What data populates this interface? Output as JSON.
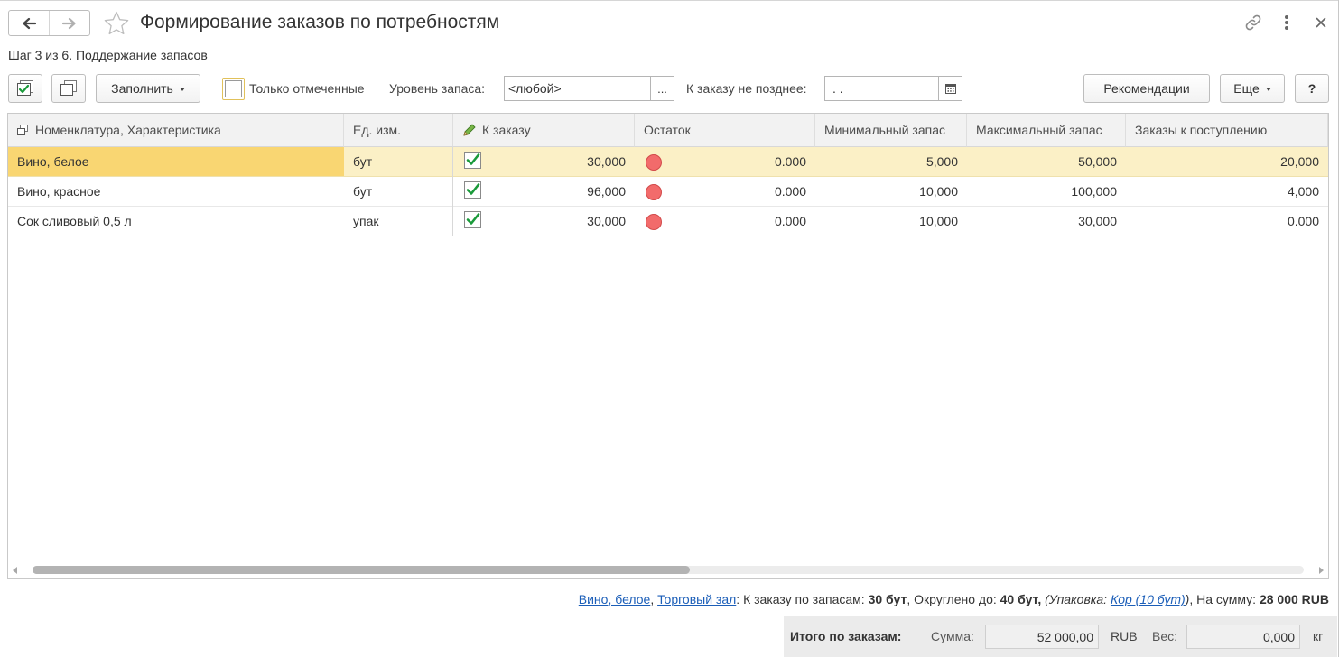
{
  "window": {
    "title": "Формирование заказов по потребностям",
    "step": "Шаг 3 из 6. Поддержание запасов"
  },
  "toolbar": {
    "fill_label": "Заполнить",
    "only_checked_label": "Только отмеченные",
    "stock_level_label": "Уровень запаса:",
    "stock_level_value": "<любой>",
    "stock_level_btn": "...",
    "order_by_label": "К заказу не позднее:",
    "order_by_value": " .  .",
    "recommend_label": "Рекомендации",
    "more_label": "Еще",
    "help_label": "?"
  },
  "table": {
    "columns": [
      "Номенклатура, Характеристика",
      "Ед. изм.",
      "К заказу",
      "Остаток",
      "Минимальный запас",
      "Максимальный запас",
      "Заказы к поступлению"
    ],
    "rows": [
      {
        "name": "Вино, белое",
        "unit": "бут",
        "checked": true,
        "to_order": "30,000",
        "stock": "0.000",
        "min": "5,000",
        "max": "50,000",
        "incoming": "20,000"
      },
      {
        "name": "Вино, красное",
        "unit": "бут",
        "checked": true,
        "to_order": "96,000",
        "stock": "0.000",
        "min": "10,000",
        "max": "100,000",
        "incoming": "4,000"
      },
      {
        "name": "Сок сливовый 0,5 л",
        "unit": "упак",
        "checked": true,
        "to_order": "30,000",
        "stock": "0.000",
        "min": "10,000",
        "max": "30,000",
        "incoming": "0.000"
      }
    ],
    "scroll_position": 0.0
  },
  "info": {
    "item_link": "Вино, белое",
    "comma": ",",
    "store_link": "Торговый зал",
    "t1": ": К заказу по запасам: ",
    "b1": "30 бут",
    "t2": ", Округлено до: ",
    "b2": "40 бут,",
    "t3": " ",
    "i1": "(Упаковка: ",
    "pack_link": "Кор (10 бут)",
    "i2": ")",
    "t4": ", На сумму: ",
    "b3": "28 000 RUB"
  },
  "totals": {
    "label": "Итого по заказам:",
    "sum_label": "Сумма:",
    "sum_value": "52 000,00",
    "currency": "RUB",
    "weight_label": "Вес:",
    "weight_value": "0,000",
    "weight_unit": "кг"
  },
  "colors": {
    "selected_row": "#fbf0c6",
    "selected_cell": "#f9d672",
    "check_green": "#1a9a3a",
    "status_red": "#f26b6b",
    "link": "#1b5eb8"
  }
}
